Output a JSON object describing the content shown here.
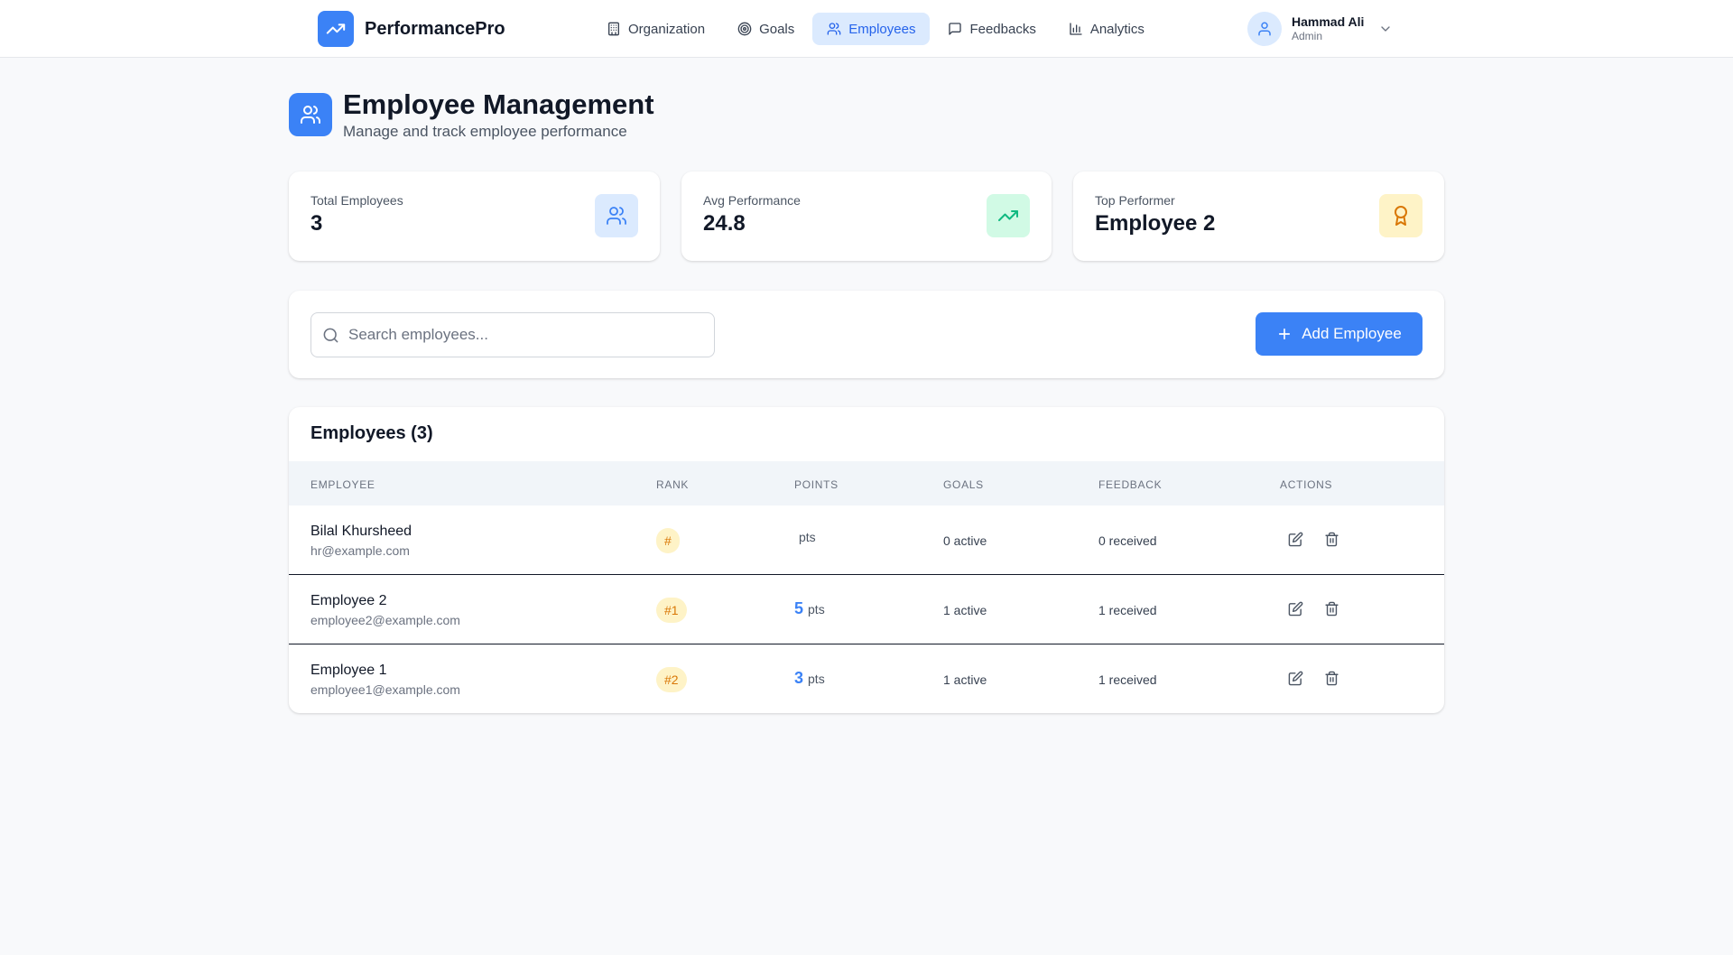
{
  "app": {
    "name": "PerformancePro",
    "logo_icon": "trending-up-icon",
    "accent_color": "#3b82f6"
  },
  "nav": {
    "items": [
      {
        "label": "Organization",
        "icon": "building-icon"
      },
      {
        "label": "Goals",
        "icon": "target-icon"
      },
      {
        "label": "Employees",
        "icon": "users-icon",
        "active": true
      },
      {
        "label": "Feedbacks",
        "icon": "message-icon"
      },
      {
        "label": "Analytics",
        "icon": "bar-chart-icon"
      }
    ]
  },
  "user": {
    "name": "Hammad Ali",
    "role": "Admin",
    "avatar_icon": "user-icon"
  },
  "header": {
    "title": "Employee Management",
    "subtitle": "Manage and track employee performance",
    "icon": "users-icon"
  },
  "stats": [
    {
      "label": "Total Employees",
      "value": "3",
      "icon": "users-icon",
      "color": "#dbeafe"
    },
    {
      "label": "Avg Performance",
      "value": "24.8",
      "icon": "trending-up-icon",
      "color": "#d1fae5"
    },
    {
      "label": "Top Performer",
      "value": "Employee 2",
      "icon": "award-icon",
      "color": "#fef3c7"
    }
  ],
  "search": {
    "placeholder": "Search employees...",
    "value": ""
  },
  "add_button": {
    "label": "Add Employee"
  },
  "table": {
    "title": "Employees (3)",
    "columns": [
      "EMPLOYEE",
      "RANK",
      "POINTS",
      "GOALS",
      "FEEDBACK",
      "ACTIONS"
    ],
    "rows": [
      {
        "name": "Bilal Khursheed",
        "email": "hr@example.com",
        "rank": "#",
        "points": "",
        "points_unit": "pts",
        "goals": "0 active",
        "feedback": "0 received"
      },
      {
        "name": "Employee 2",
        "email": "employee2@example.com",
        "rank": "#1",
        "points": "5",
        "points_unit": "pts",
        "goals": "1 active",
        "feedback": "1 received"
      },
      {
        "name": "Employee 1",
        "email": "employee1@example.com",
        "rank": "#2",
        "points": "3",
        "points_unit": "pts",
        "goals": "1 active",
        "feedback": "1 received"
      }
    ]
  }
}
